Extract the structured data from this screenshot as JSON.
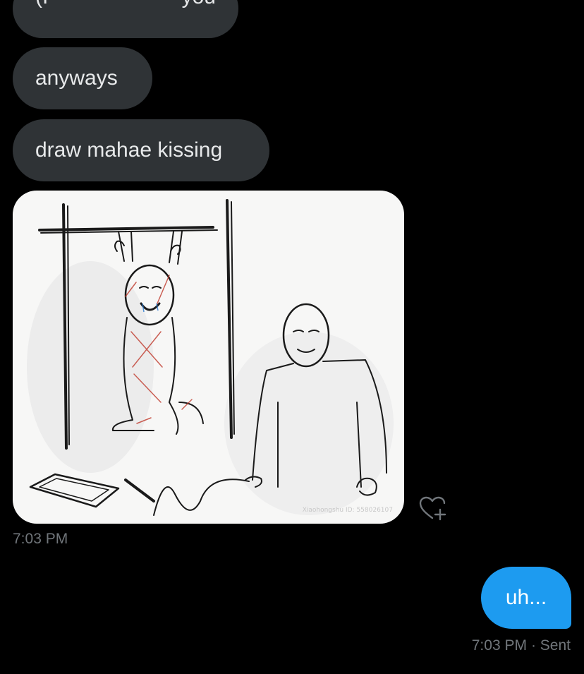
{
  "messages": {
    "cut_top": {
      "left_text": "(I",
      "right_text": "you"
    },
    "received_1": "anyways",
    "received_2": "draw mahae kissing",
    "image": {
      "watermark": "Xiaohongshu ID: 558026107"
    },
    "received_timestamp": "7:03 PM",
    "sent_1": "uh...",
    "sent_timestamp": "7:03 PM",
    "sent_status": "· Sent"
  },
  "icons": {
    "react": "heart-plus-icon"
  },
  "colors": {
    "background": "#000000",
    "received_bubble": "#2f3336",
    "sent_bubble": "#1d9bf0",
    "timestamp": "#71767b",
    "text": "#e7e9ea"
  }
}
